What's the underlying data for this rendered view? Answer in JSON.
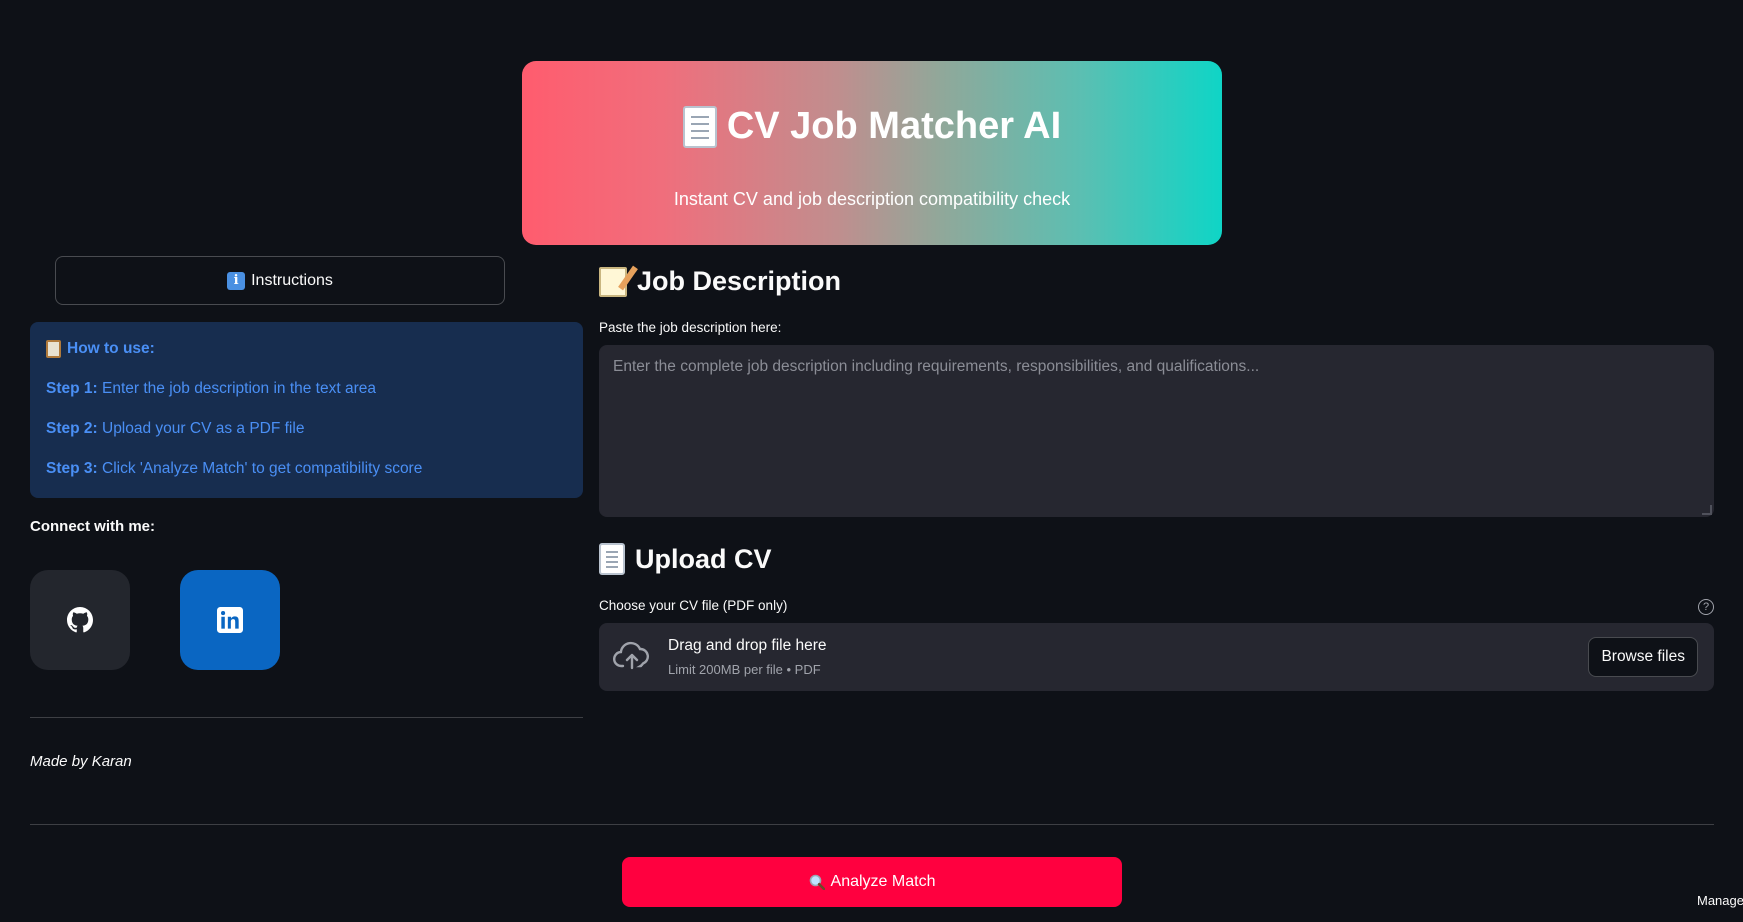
{
  "header": {
    "title": "CV Job Matcher AI",
    "subtitle": "Instant CV and job description compatibility check",
    "gradient_start": "#ff5c6e",
    "gradient_end": "#0fd5c6"
  },
  "sidebar": {
    "instructions_label": "Instructions",
    "howto": {
      "title": "How to use:",
      "steps": [
        {
          "label": "Step 1:",
          "text": " Enter the job description in the text area"
        },
        {
          "label": "Step 2:",
          "text": " Upload your CV as a PDF file"
        },
        {
          "label": "Step 3:",
          "text": " Click 'Analyze Match' to get compatibility score"
        }
      ]
    },
    "connect_label": "Connect with me:",
    "social": [
      {
        "name": "github",
        "icon": "github-icon",
        "color": "#23262d"
      },
      {
        "name": "linkedin",
        "icon": "linkedin-icon",
        "color": "#0a66c2"
      }
    ],
    "made_by": "Made by Karan"
  },
  "main": {
    "job_description": {
      "heading": "Job Description",
      "label": "Paste the job description here:",
      "placeholder": "Enter the complete job description including requirements, responsibilities, and qualifications...",
      "value": ""
    },
    "upload": {
      "heading": "Upload CV",
      "label": "Choose your CV file (PDF only)",
      "drop_title": "Drag and drop file here",
      "drop_limit": "Limit 200MB per file • PDF",
      "browse_label": "Browse files"
    },
    "analyze_label": "Analyze Match",
    "analyze_color": "#ff003f"
  },
  "footer": {
    "manage_app_label": "Manage app"
  }
}
